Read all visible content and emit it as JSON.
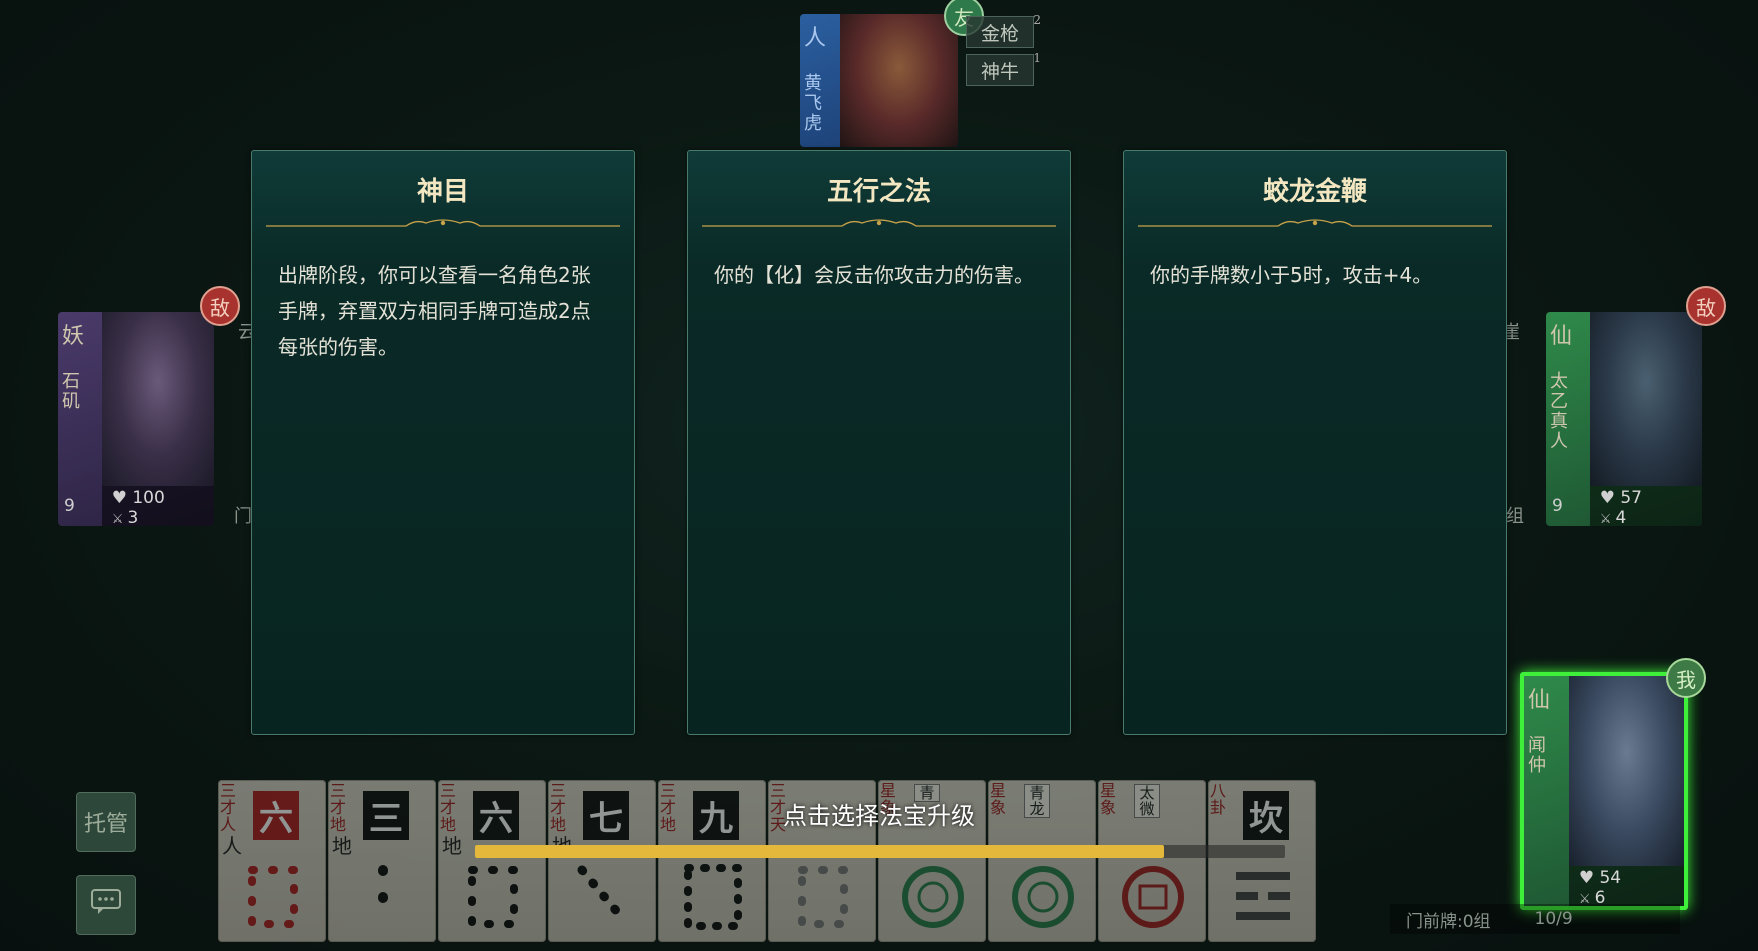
{
  "top_player": {
    "faction": "人",
    "name": "黄飞虎",
    "relation_badge": "友",
    "weapons": [
      {
        "label": "金枪",
        "count": "2"
      },
      {
        "label": "神牛",
        "count": "1"
      }
    ]
  },
  "left_player": {
    "faction": "妖",
    "name": "石矶",
    "relation_badge": "敌",
    "level": "9",
    "hp": "100",
    "attack": "3",
    "side_tag_top": "云",
    "side_tag_bottom": "门"
  },
  "right_player": {
    "faction": "仙",
    "name": "太乙真人",
    "relation_badge": "敌",
    "level": "9",
    "hp": "57",
    "attack": "4",
    "side_tag_top": "崖",
    "side_tag_bottom": "组"
  },
  "me": {
    "faction": "仙",
    "name": "闻仲",
    "relation_badge": "我",
    "hp": "54",
    "attack": "6"
  },
  "choices": [
    {
      "title": "神目",
      "description": "出牌阶段，你可以查看一名角色2张手牌，弃置双方相同手牌可造成2点每张的伤害。"
    },
    {
      "title": "五行之法",
      "description": "你的【化】会反击你攻击力的伤害。"
    },
    {
      "title": "蛟龙金鞭",
      "description": "你的手牌数小于5时，攻击+4。"
    }
  ],
  "hand": [
    {
      "category": "三才人",
      "glyph": "六",
      "red": true,
      "sub": "人"
    },
    {
      "category": "三才地",
      "glyph": "三",
      "red": false,
      "sub": "地"
    },
    {
      "category": "三才地",
      "glyph": "六",
      "red": false,
      "sub": "地"
    },
    {
      "category": "三才地",
      "glyph": "七",
      "red": false,
      "sub": "地"
    },
    {
      "category": "三才地",
      "glyph": "九",
      "red": false,
      "sub": ""
    },
    {
      "category": "三才天",
      "glyph": "",
      "red": false,
      "sub": ""
    },
    {
      "category": "星象",
      "glyph": "青",
      "red": false,
      "sub": ""
    },
    {
      "category": "星象",
      "glyph": "青龙",
      "red": false,
      "sub": ""
    },
    {
      "category": "星象",
      "glyph": "太微",
      "red": false,
      "sub": ""
    },
    {
      "category": "八卦",
      "glyph": "坎",
      "red": false,
      "sub": ""
    }
  ],
  "prompt": "点击选择法宝升级",
  "progress": 0.85,
  "buttons": {
    "auto": "托管",
    "chat_icon": "chat-icon"
  },
  "door_info": {
    "groups": "门前牌:0组",
    "cards": "10/9"
  },
  "colors": {
    "accent": "#e4b83a",
    "me_highlight": "#3ef03a",
    "enemy": "#a8322e",
    "friend": "#2f7a4a"
  }
}
